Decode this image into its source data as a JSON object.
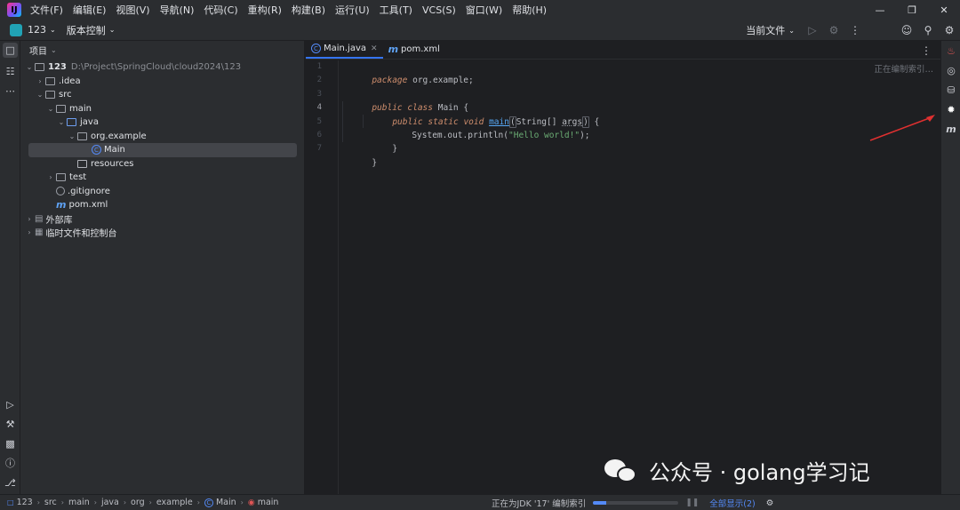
{
  "menubar": {
    "logo": "IJ",
    "items": [
      "文件(F)",
      "编辑(E)",
      "视图(V)",
      "导航(N)",
      "代码(C)",
      "重构(R)",
      "构建(B)",
      "运行(U)",
      "工具(T)",
      "VCS(S)",
      "窗口(W)",
      "帮助(H)"
    ]
  },
  "toolbar": {
    "project_name": "123",
    "vcs_label": "版本控制",
    "run_config": "当前文件"
  },
  "project_panel": {
    "header": "项目",
    "tree": [
      {
        "label": "123",
        "path": "D:\\Project\\SpringCloud\\cloud2024\\123"
      },
      {
        "label": ".idea"
      },
      {
        "label": "src"
      },
      {
        "label": "main"
      },
      {
        "label": "java"
      },
      {
        "label": "org.example"
      },
      {
        "label": "Main"
      },
      {
        "label": "resources"
      },
      {
        "label": "test"
      },
      {
        "label": ".gitignore"
      },
      {
        "label": "pom.xml"
      },
      {
        "label": "外部库"
      },
      {
        "label": "临时文件和控制台"
      }
    ]
  },
  "editor": {
    "tabs": [
      {
        "label": "Main.java",
        "active": true
      },
      {
        "label": "pom.xml",
        "active": false
      }
    ],
    "indexing_hint": "正在编制索引…",
    "line_numbers": [
      "1",
      "2",
      "3",
      "4",
      "5",
      "6",
      "7"
    ],
    "code": {
      "l1_kw": "package",
      "l1_rest": " org.example;",
      "l3_kw1": "public",
      "l3_kw2": "class",
      "l3_name": " Main {",
      "l4_kw1": "public",
      "l4_kw2": "static",
      "l4_kw3": "void",
      "l4_fn": "main",
      "l4_open": "(",
      "l4_type": "String[] ",
      "l4_param": "args",
      "l4_close": ")",
      "l4_brace": " {",
      "l5_call": "System.out.println(",
      "l5_str": "\"Hello world!\"",
      "l5_end": ");",
      "l6": "}",
      "l7": "}"
    }
  },
  "statusbar": {
    "breadcrumbs": [
      "123",
      "src",
      "main",
      "java",
      "org",
      "example",
      "Main",
      "main"
    ],
    "indexing_text": "正在为JDK '17' 编制索引",
    "indexing_progress": 0.15,
    "show_all": "全部显示(2)"
  },
  "watermark": {
    "text": "公众号 · golang学习记"
  },
  "colors": {
    "accent": "#3574f0",
    "background": "#1e1f22",
    "panel": "#2b2d30",
    "arrow": "#e03030"
  }
}
